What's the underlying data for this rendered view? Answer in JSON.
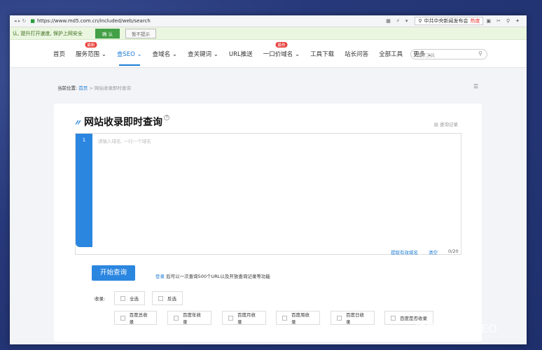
{
  "browser": {
    "url": "https://www.md5.com.cn/included/web/search",
    "news_label": "中共中央新闻发布会",
    "hot_label": "热度"
  },
  "infobar": {
    "message": "认, 提升打开速度, 保护上网安全",
    "ok_label": "确 认",
    "nohint_label": "暂不提示"
  },
  "nav": {
    "items": [
      {
        "label": "首页",
        "badge": ""
      },
      {
        "label": "服务范围",
        "badge": "最新",
        "dropdown": true
      },
      {
        "label": "查SEO",
        "badge": "",
        "dropdown": true,
        "active": true
      },
      {
        "label": "查域名",
        "badge": "",
        "dropdown": true
      },
      {
        "label": "查关键词",
        "badge": "",
        "dropdown": true
      },
      {
        "label": "URL推送",
        "badge": ""
      },
      {
        "label": "一口价域名",
        "badge": "最热",
        "dropdown": true
      },
      {
        "label": "工具下载",
        "badge": ""
      },
      {
        "label": "站长问答",
        "badge": ""
      },
      {
        "label": "全部工具",
        "badge": ""
      },
      {
        "label": "更多",
        "badge": "",
        "dropdown": true
      }
    ],
    "search_placeholder": "搜索工具"
  },
  "breadcrumb": {
    "prefix": "当前位置:",
    "home": "首页",
    "sep": ">",
    "current": "网站收录即时查询"
  },
  "main": {
    "title": "网站收录即时查询",
    "history": "查询记录",
    "line_number": "1",
    "input_placeholder": "请输入域名, 一行一个域名",
    "extract_label": "提取有效域名",
    "clear_label": "清空",
    "count": "0/20",
    "start_button": "开始查询",
    "login_link": "登录",
    "login_tip": "后可以一次查询500个URL以及开放查询记录等功能",
    "inclusion_label": "收录:",
    "select_all": "全选",
    "invert": "反选",
    "options": [
      "百度总收录",
      "百度年收录",
      "百度月收录",
      "百度周收录",
      "百度日收录",
      "百度是否收录"
    ]
  },
  "watermark": "知乎 @枫树SEO"
}
